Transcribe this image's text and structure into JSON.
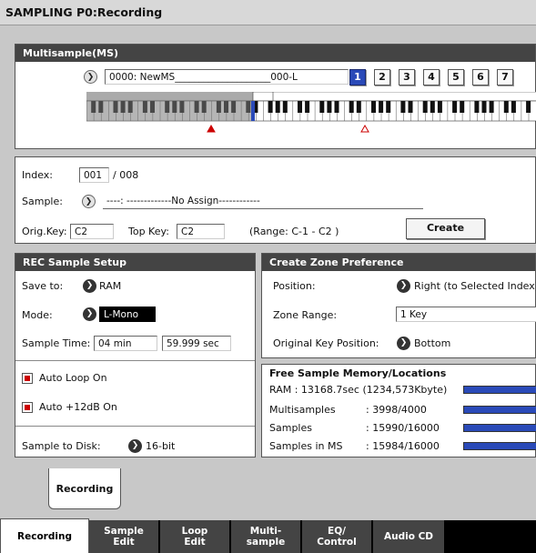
{
  "title": "SAMPLING P0:Recording",
  "multisample": {
    "header": "Multisample(MS)",
    "name": "0000: NewMS____________________000-L",
    "buttons": [
      "1",
      "2",
      "3",
      "4",
      "5",
      "6",
      "7"
    ],
    "active_button": "1"
  },
  "index": {
    "index_label": "Index:",
    "index_value": "001",
    "index_total": "/ 008",
    "sample_label": "Sample:",
    "sample_value": "----: -------------No Assign------------",
    "origkey_label": "Orig.Key:",
    "origkey_value": "C2",
    "topkey_label": "Top Key:",
    "topkey_value": "C2",
    "range_text": "(Range:  C-1   - C2    )",
    "create_label": "Create"
  },
  "rec_setup": {
    "header": "REC Sample Setup",
    "save_label": "Save to:",
    "save_value": "RAM",
    "mode_label": "Mode:",
    "mode_value": "L-Mono",
    "time_label": "Sample Time:",
    "time_min": "04 min",
    "time_sec": "59.999 sec",
    "auto_loop": "Auto Loop On",
    "auto_12db": "Auto +12dB On",
    "disk_label": "Sample to Disk:",
    "disk_value": "16-bit"
  },
  "zone_pref": {
    "header": "Create Zone Preference",
    "position_label": "Position:",
    "position_value": "Right (to Selected Index)",
    "range_label": "Zone Range:",
    "range_value": "1 Key",
    "origkey_label": "Original Key Position:",
    "origkey_value": "Bottom"
  },
  "memory": {
    "header": "Free Sample Memory/Locations",
    "ram_text": "RAM :  13168.7sec  (1234,573Kbyte)",
    "rows": [
      {
        "label": "Multisamples",
        "value": ": 3998/4000"
      },
      {
        "label": "Samples",
        "value": ": 15990/16000"
      },
      {
        "label": "Samples in MS",
        "value": ": 15984/16000"
      }
    ],
    "levels": [
      1.0,
      1.0,
      1.0,
      1.0
    ]
  },
  "subtab": "Recording",
  "tabs": [
    {
      "label": "Recording"
    },
    {
      "label": "Sample\nEdit"
    },
    {
      "label": "Loop\nEdit"
    },
    {
      "label": "Multi-\nsample"
    },
    {
      "label": "EQ/\nControl"
    },
    {
      "label": "Audio CD"
    }
  ],
  "colors": {
    "accent": "#2a4ab8",
    "header_bg": "#444444",
    "marker": "#cc0000"
  }
}
